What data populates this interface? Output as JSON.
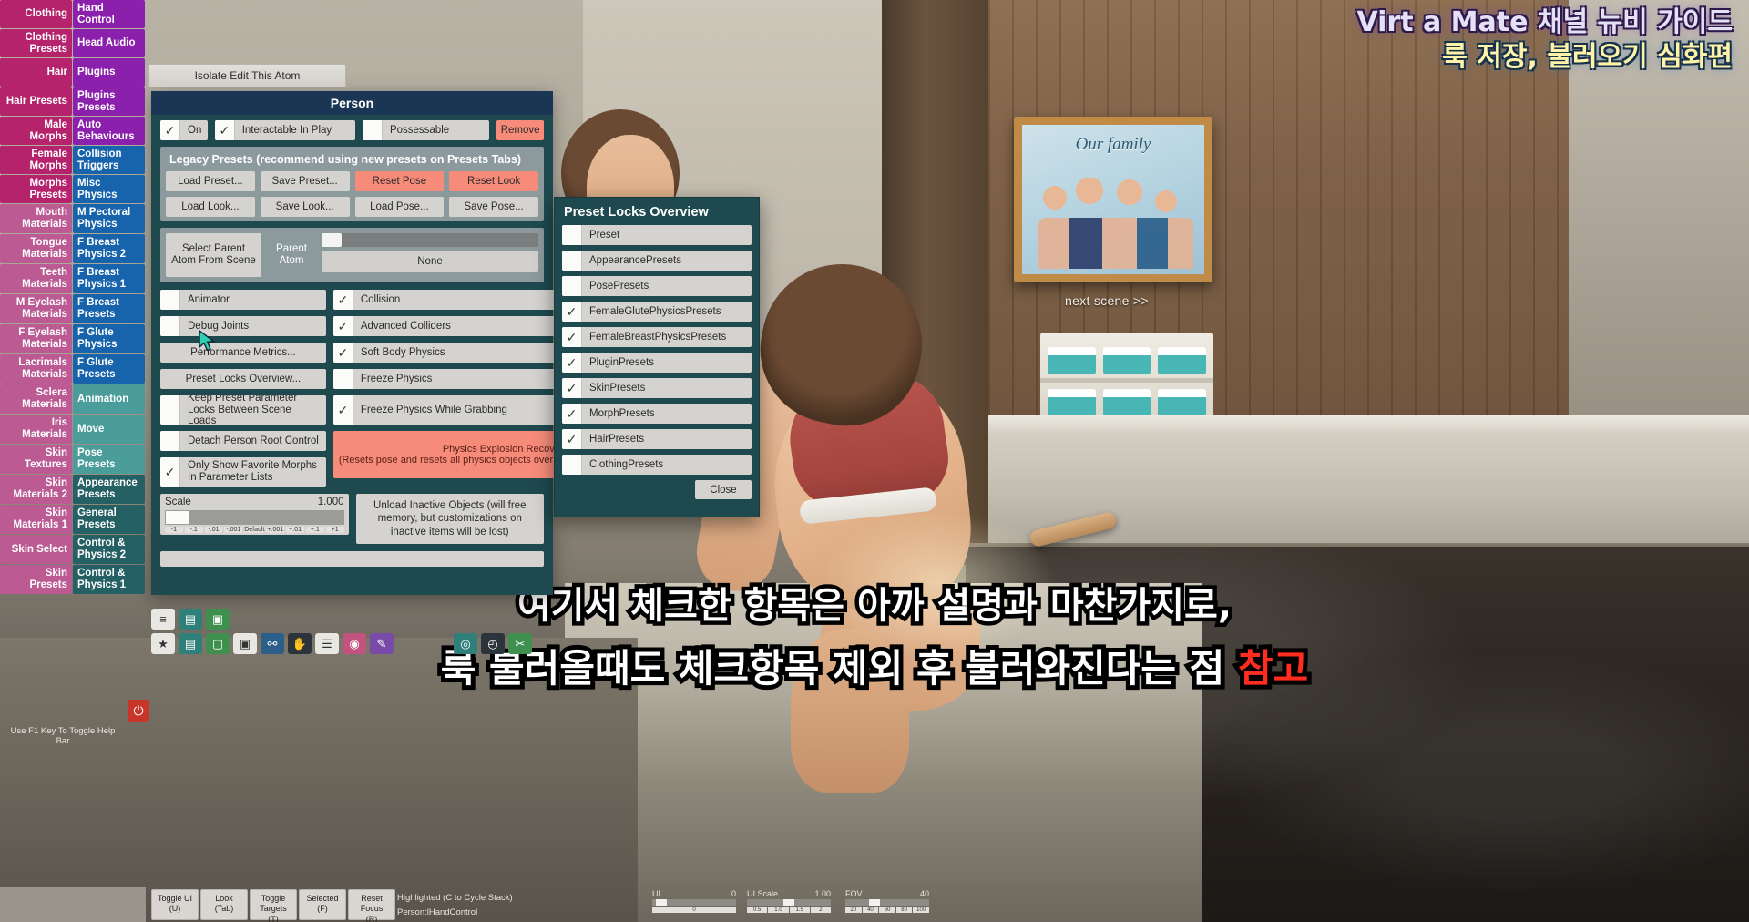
{
  "overlay": {
    "title_line1": "Virt a Mate 채널 뉴비 가이드",
    "title_line2": "룩 저장, 불러오기 심화편",
    "subtitle_line1": "여기서 체크한 항목은 아까 설명과 마찬가지로,",
    "subtitle_line2_a": "룩 불러올때도 체크항목 제외 후 불러와진다는 점 ",
    "subtitle_line2_b": "참고",
    "next_scene": "next scene >>",
    "picture_caption": "Our family"
  },
  "sidebar": {
    "left_column": [
      "Clothing",
      "Clothing Presets",
      "Hair",
      "Hair Presets",
      "Male Morphs",
      "Female Morphs",
      "Morphs Presets",
      "Mouth Materials",
      "Tongue Materials",
      "Teeth Materials",
      "M Eyelash Materials",
      "F Eyelash Materials",
      "Lacrimals Materials",
      "Sclera Materials",
      "Iris Materials",
      "Skin Textures",
      "Skin Materials 2",
      "Skin Materials 1",
      "Skin Select",
      "Skin Presets"
    ],
    "right_column": [
      "Hand Control",
      "Head Audio",
      "Plugins",
      "Plugins Presets",
      "Auto Behaviours",
      "Collision Triggers",
      "Misc Physics",
      "M Pectoral Physics",
      "F Breast Physics 2",
      "F Breast Physics 1",
      "F Breast Presets",
      "F Glute Physics",
      "F Glute Presets",
      "Animation",
      "Move",
      "Pose Presets",
      "Appearance Presets",
      "General Presets",
      "Control & Physics 2",
      "Control & Physics 1"
    ],
    "colors": {
      "magenta": "#b5236c",
      "magenta_light": "#bb5a93",
      "purple": "#8b20ad",
      "blue": "#1764ad",
      "teal_light": "#4a9d9a",
      "teal_dark": "#256065"
    }
  },
  "isolate_button": {
    "label": "Isolate Edit This Atom"
  },
  "person_panel": {
    "title": "Person",
    "top_toggles": [
      {
        "label": "On",
        "checked": true
      },
      {
        "label": "Interactable In Play",
        "checked": true
      },
      {
        "label": "Possessable",
        "checked": false
      }
    ],
    "remove_button": "Remove",
    "legacy": {
      "title": "Legacy Presets (recommend using new presets on Presets Tabs)",
      "row1": [
        "Load Preset...",
        "Save Preset...",
        "Reset Pose",
        "Reset Look"
      ],
      "row2": [
        "Load Look...",
        "Save Look...",
        "Load Pose...",
        "Save Pose..."
      ],
      "red_buttons": [
        "Reset Pose",
        "Reset Look"
      ]
    },
    "parent": {
      "select_button": "Select Parent Atom From Scene",
      "label": "Parent Atom",
      "value": "None"
    },
    "left_controls": [
      {
        "type": "checkbox",
        "label": "Animator",
        "checked": false
      },
      {
        "type": "checkbox",
        "label": "Debug Joints",
        "checked": false
      },
      {
        "type": "button",
        "label": "Performance Metrics..."
      },
      {
        "type": "button",
        "label": "Preset Locks Overview..."
      },
      {
        "type": "checkbox",
        "label": "Keep Preset Parameter Locks Between Scene Loads",
        "checked": false
      },
      {
        "type": "checkbox",
        "label": "Detach Person Root Control",
        "checked": false
      },
      {
        "type": "checkbox",
        "label": "Only Show Favorite Morphs In Parameter Lists",
        "checked": true
      }
    ],
    "right_controls": [
      {
        "type": "checkbox",
        "label": "Collision",
        "checked": true
      },
      {
        "type": "checkbox",
        "label": "Advanced Colliders",
        "checked": true
      },
      {
        "type": "checkbox",
        "label": "Soft Body Physics",
        "checked": true
      },
      {
        "type": "checkbox",
        "label": "Freeze Physics",
        "checked": false
      },
      {
        "type": "checkbox",
        "label": "Freeze Physics While Grabbing",
        "checked": true
      },
      {
        "type": "button_red",
        "label": "Physics Explosion Recovery (Resets pose and resets all physics objects over several frames to recover)"
      }
    ],
    "scale": {
      "label": "Scale",
      "value": "1.000",
      "ticks": [
        "-1",
        "-.1",
        "-.01",
        "-.001",
        "Default",
        "+.001",
        "+.01",
        "+.1",
        "+1"
      ]
    },
    "unload": "Unload Inactive Objects (will free memory, but customizations on inactive items will be lost)"
  },
  "preset_locks_dialog": {
    "title": "Preset Locks Overview",
    "items": [
      {
        "label": "Preset",
        "checked": false
      },
      {
        "label": "AppearancePresets",
        "checked": false
      },
      {
        "label": "PosePresets",
        "checked": false
      },
      {
        "label": "FemaleGlutePhysicsPresets",
        "checked": true
      },
      {
        "label": "FemaleBreastPhysicsPresets",
        "checked": true
      },
      {
        "label": "PluginPresets",
        "checked": true
      },
      {
        "label": "SkinPresets",
        "checked": true
      },
      {
        "label": "MorphPresets",
        "checked": true
      },
      {
        "label": "HairPresets",
        "checked": true
      },
      {
        "label": "ClothingPresets",
        "checked": false
      }
    ],
    "close_button": "Close"
  },
  "icon_toolbar": {
    "row1": [
      "menu-icon",
      "save-icon",
      "folder-icon"
    ],
    "row2": [
      "star-icon",
      "load-icon",
      "screen-icon",
      "camera-icon",
      "link-icon",
      "hand-icon",
      "list-icon",
      "record-icon",
      "tools-icon",
      "target-icon",
      "clock-icon",
      "wrench-icon"
    ]
  },
  "power_button": {
    "icon": "power-icon"
  },
  "f1_hint": "Use F1 Key To Toggle Help Bar",
  "statusbar": {
    "buttons": [
      "Toggle UI (U)",
      "Look (Tab)",
      "Toggle Targets (T)",
      "Selected (F)",
      "Reset Focus (R)"
    ],
    "highlight_line1": "Highlighted (C to Cycle Stack)",
    "highlight_line2": "Person:lHandControl",
    "sliders": [
      {
        "label": "UI",
        "value": "0",
        "ticks": [
          "0"
        ]
      },
      {
        "label": "UI Scale",
        "value": "1.00",
        "ticks": [
          "0.5",
          "1.0",
          "1.5",
          "2"
        ]
      },
      {
        "label": "FOV",
        "value": "40",
        "ticks": [
          "20",
          "40",
          "60",
          "80",
          "100"
        ]
      }
    ]
  }
}
